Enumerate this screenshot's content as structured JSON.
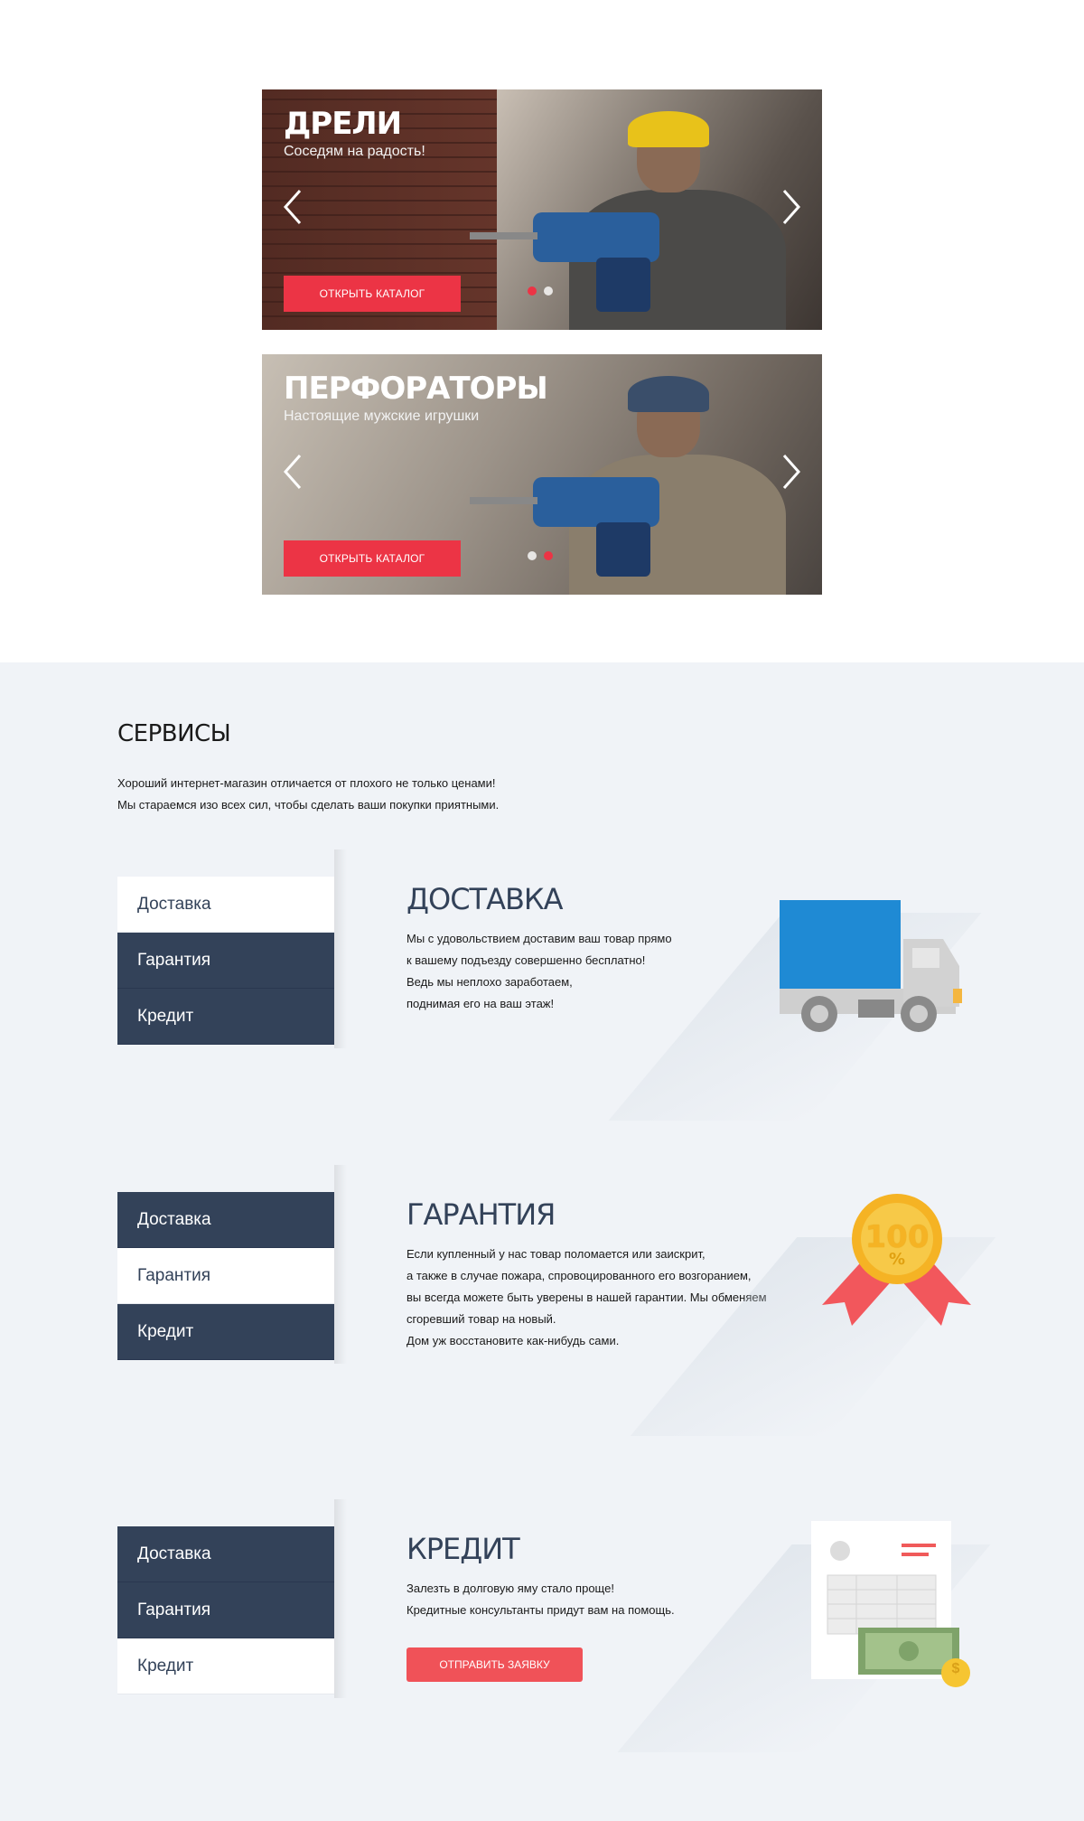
{
  "banners": [
    {
      "title": "ДРЕЛИ",
      "subtitle": "Соседям на радость!",
      "button": "ОТКРЫТЬ КАТАЛОГ",
      "prev_icon": "chevron-left-icon",
      "next_icon": "chevron-right-icon"
    },
    {
      "title": "ПЕРФОРАТОРЫ",
      "subtitle": "Настоящие мужские игрушки",
      "button": "ОТКРЫТЬ КАТАЛОГ",
      "prev_icon": "chevron-left-icon",
      "next_icon": "chevron-right-icon"
    }
  ],
  "services": {
    "title": "СЕРВИСЫ",
    "intro_line1": "Хороший интернет-магазин отличается от плохого не только ценами!",
    "intro_line2": "Мы стараемся изо всех сил, чтобы сделать ваши покупки приятными.",
    "tabs": [
      "Доставка",
      "Гарантия",
      "Кредит"
    ],
    "delivery": {
      "name": "ДОСТАВКА",
      "lines": [
        "Мы с удовольствием доставим ваш товар прямо",
        "к вашему подъезду совершенно бесплатно!",
        "Ведь мы неплохо заработаем,",
        "поднимая его на ваш этаж!"
      ],
      "icon": "truck-icon"
    },
    "warranty": {
      "name": "ГАРАНТИЯ",
      "lines": [
        "Если купленный у нас товар поломается или заискрит,",
        "а также в случае пожара, спровоцированного его возгоранием,",
        "вы всегда можете быть уверены в нашей гарантии. Мы обменяем",
        "сгоревший товар на новый.",
        "Дом уж восстановите как-нибудь сами."
      ],
      "badge_text": "100",
      "badge_unit": "%",
      "icon": "warranty-badge-icon"
    },
    "credit": {
      "name": "КРЕДИТ",
      "lines": [
        "Залезть в долговую яму стало проще!",
        "Кредитные консультанты придут вам на помощь."
      ],
      "button": "ОТПРАВИТЬ ЗАЯВКУ",
      "coin_symbol": "$",
      "icon": "credit-document-icon"
    }
  },
  "colors": {
    "accent": "#ec3445",
    "navy": "#334259",
    "bg_light": "#f0f3f7"
  }
}
